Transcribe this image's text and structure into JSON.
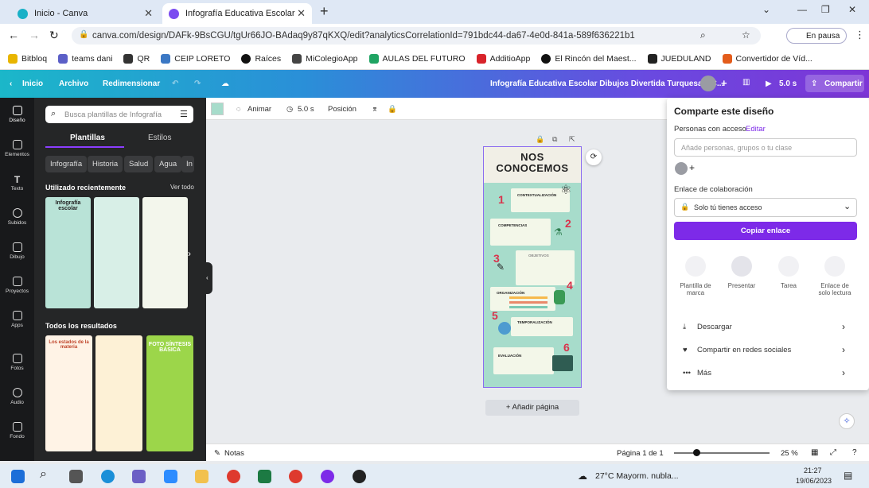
{
  "browser": {
    "tabs": [
      {
        "label": "Inicio - Canva"
      },
      {
        "label": "Infografía Educativa Escolar Dib..."
      }
    ],
    "url": "canva.com/design/DAFk-9BsCGU/tgUr66JO-BAdaq9y87qKXQ/edit?analyticsCorrelationId=791bdc44-da67-4e0d-841a-589f636221b1",
    "profile": "En pausa",
    "bookmarks": [
      "Bitbloq",
      "teams dani",
      "QR",
      "CEIP LORETO",
      "Raíces",
      "MiColegioApp",
      "AULAS DEL FUTURO",
      "AdditioApp",
      "El Rincón del Maest...",
      "JUEDULAND",
      "Convertidor de Víd..."
    ]
  },
  "header": {
    "back": "Inicio",
    "file": "Archivo",
    "resize": "Redimensionar",
    "title": "Infografía Educativa Escolar Dibujos Divertida Turquesa y C...",
    "timer": "5.0 s",
    "share": "Compartir"
  },
  "rail": [
    "Diseño",
    "Elementos",
    "Texto",
    "Subidos",
    "Dibujo",
    "Proyectos",
    "Apps",
    "Fotos",
    "Audio",
    "Fondo"
  ],
  "panel": {
    "search_placeholder": "Busca plantillas de Infografía",
    "tab1": "Plantillas",
    "tab2": "Estilos",
    "chips": [
      "Infografía",
      "Historia",
      "Salud",
      "Agua",
      "In"
    ],
    "recent": "Utilizado recientemente",
    "see_all": "Ver todo",
    "all": "Todos los resultados",
    "thumb_titles": [
      "Infografía escolar",
      "Los estados de la materia",
      "FOTO SÍNTESIS BÁSICA"
    ]
  },
  "toolbar": {
    "animate": "Animar",
    "time": "5.0 s",
    "position": "Posición"
  },
  "design": {
    "title": "NOS CONOCEMOS",
    "sections": [
      "CONTEXTUALIZACIÓN",
      "COMPETENCIAS",
      "OBJETIVOS",
      "ORGANIZACIÓN",
      "TEMPORALIZACIÓN",
      "EVALUACIÓN"
    ],
    "numbers": [
      "1",
      "2",
      "3",
      "4",
      "5",
      "6"
    ]
  },
  "add_page": "+ Añadir página",
  "share": {
    "title": "Comparte este diseño",
    "access_label": "Personas con acceso",
    "edit": "Editar",
    "add_placeholder": "Añade personas, grupos o tu clase",
    "link_label": "Enlace de colaboración",
    "link_value": "Solo tú tienes acceso",
    "copy": "Copiar enlace",
    "options": [
      "Plantilla de marca",
      "Presentar",
      "Tarea",
      "Enlace de solo lectura"
    ],
    "list": [
      "Descargar",
      "Compartir en redes sociales",
      "Más"
    ]
  },
  "footer": {
    "notes": "Notas",
    "page": "Página 1 de 1",
    "zoom": "25 %"
  },
  "taskbar": {
    "weather": "27°C  Mayorm. nubla...",
    "time": "21:27",
    "date": "19/06/2023"
  }
}
